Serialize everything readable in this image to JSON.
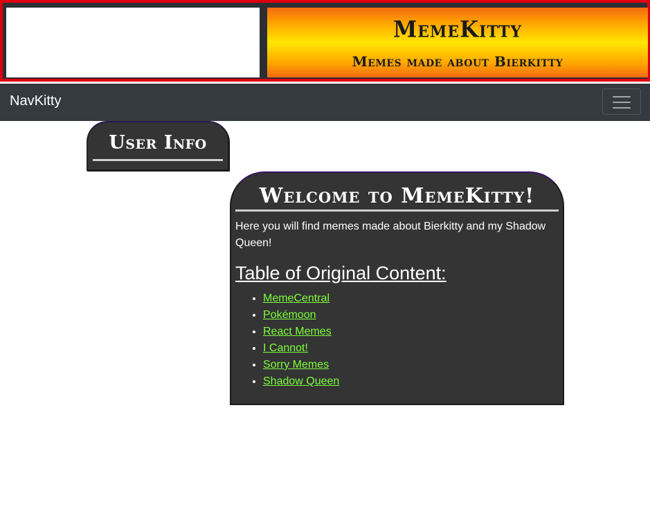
{
  "banner": {
    "title": "MemeKitty",
    "subtitle": "Memes made about Bierkitty"
  },
  "navbar": {
    "brand": "NavKitty",
    "toggler_icon": "hamburger-icon"
  },
  "user_info": {
    "title": "User Info"
  },
  "welcome": {
    "title": "Welcome to MemeKitty!",
    "intro": "Here you will find memes made about Bierkitty and my Shadow Queen!",
    "toc_heading": "Table of Original Content:",
    "links": [
      {
        "label": "MemeCentral"
      },
      {
        "label": "Pokémoon"
      },
      {
        "label": "React Memes"
      },
      {
        "label": "I Cannot!"
      },
      {
        "label": "Sorry Memes"
      },
      {
        "label": "Shadow Queen"
      }
    ]
  },
  "colors": {
    "banner_border": "#e0000f",
    "navbar_bg": "#343a40",
    "card_bg": "#343434",
    "link": "#7cff3a"
  }
}
